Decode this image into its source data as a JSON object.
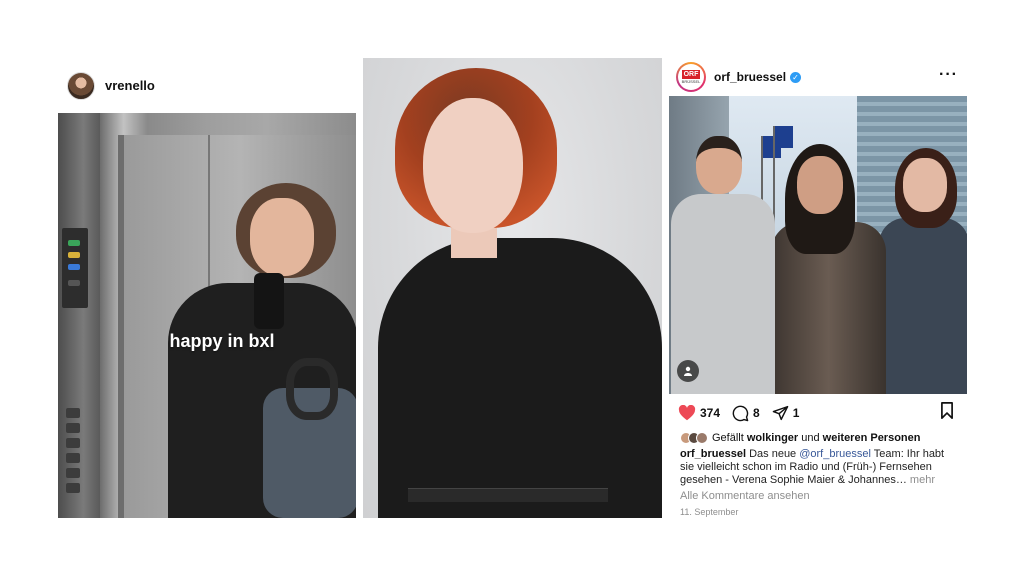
{
  "story": {
    "username": "vrenello",
    "caption": "happy in bxl"
  },
  "post": {
    "username": "orf_bruessel",
    "avatar_logo": "ORF",
    "avatar_sub": "BRÜSSEL",
    "more_label": "···",
    "likes_count": "374",
    "comments_count": "8",
    "shares_count": "1",
    "liked_by_prefix": "Gefällt ",
    "liked_by_user": "wolkinger",
    "liked_by_middle": " und ",
    "liked_by_rest": "weiteren Personen",
    "caption_user": "orf_bruessel",
    "caption_pre": " Das neue ",
    "caption_mention": "@orf_bruessel",
    "caption_text": " Team: Ihr habt sie vielleicht schon im Radio und (Früh-) Fernsehen gesehen - Verena Sophie Maier & Johannes…",
    "caption_more": " mehr",
    "view_comments": "Alle Kommentare ansehen",
    "date": "11. September"
  },
  "colors": {
    "like_red": "#ed4956",
    "verified_blue": "#2d9cf5",
    "orf_red": "#d8232a",
    "muted_gray": "#8e8e8e"
  },
  "icons": [
    "heart-icon",
    "comment-icon",
    "share-icon",
    "bookmark-icon",
    "verified-icon",
    "more-icon",
    "tag-person-icon"
  ]
}
